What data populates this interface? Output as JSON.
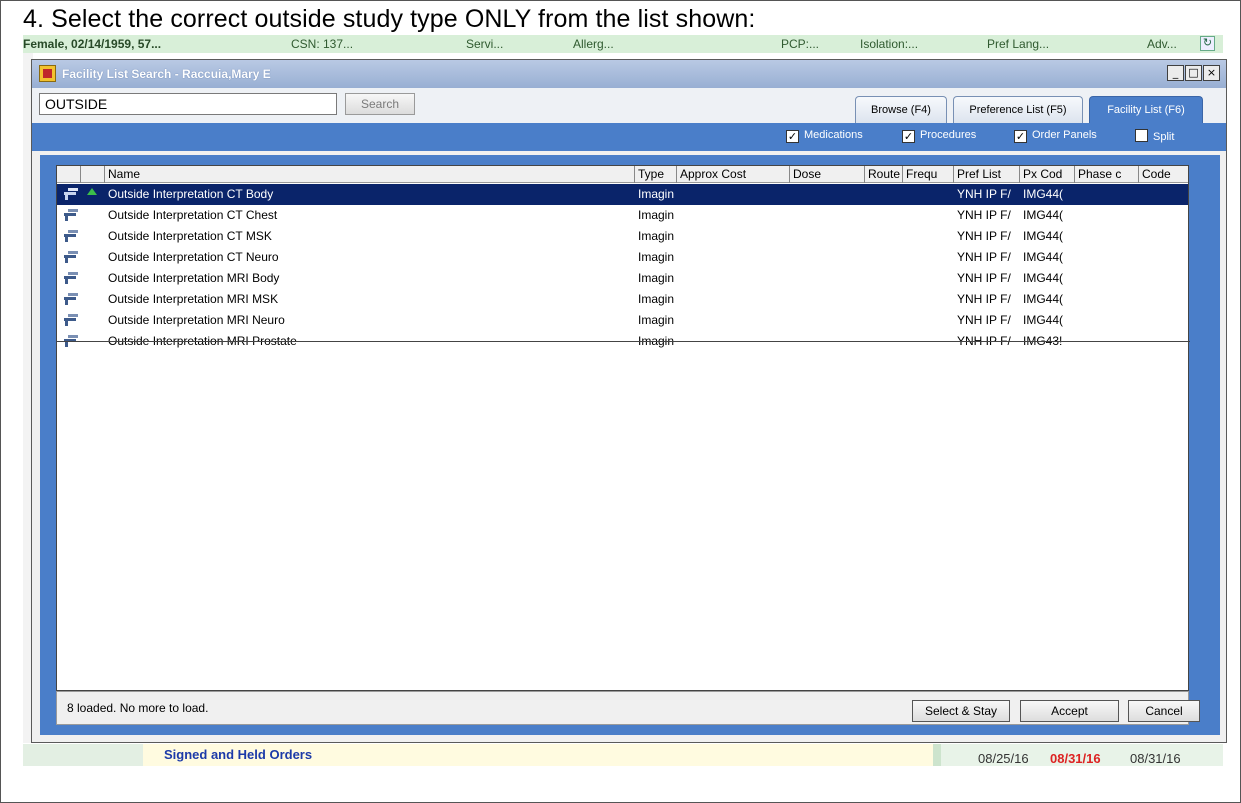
{
  "instruction": "4. Select the correct outside study type ONLY from the list shown:",
  "patient_bar": {
    "patient": "Female, 02/14/1959, 57...",
    "csn": "CSN: 137...",
    "service": "Servi...",
    "allergies": "Allerg...",
    "pcp": "PCP:...",
    "isolation": "Isolation:...",
    "pref_lang": "Pref Lang...",
    "adv": "Adv..."
  },
  "dialog": {
    "title": "Facility List Search - Raccuia,Mary E",
    "window_buttons": {
      "minimize": "_",
      "maximize": "□",
      "close": "×"
    },
    "search": {
      "value": "OUTSIDE",
      "button_label": "Search"
    },
    "tabs": [
      {
        "label": "Browse (F4)",
        "active": false
      },
      {
        "label": "Preference List (F5)",
        "active": false
      },
      {
        "label": "Facility List (F6)",
        "active": true
      }
    ],
    "filters": [
      {
        "label": "Medications",
        "checked": true
      },
      {
        "label": "Procedures",
        "checked": true
      },
      {
        "label": "Order Panels",
        "checked": true
      },
      {
        "label": "Split",
        "checked": false
      }
    ],
    "columns": [
      "Name",
      "Type",
      "Approx Cost",
      "Dose",
      "Route",
      "Frequ",
      "Pref List",
      "Px Cod",
      "Phase c",
      "Code"
    ],
    "rows": [
      {
        "name": "Outside Interpretation CT Body",
        "type": "Imagin",
        "pref_list": "YNH IP F/",
        "px_code": "IMG44(",
        "selected": true
      },
      {
        "name": "Outside Interpretation CT Chest",
        "type": "Imagin",
        "pref_list": "YNH IP F/",
        "px_code": "IMG44(",
        "selected": false
      },
      {
        "name": "Outside Interpretation CT MSK",
        "type": "Imagin",
        "pref_list": "YNH IP F/",
        "px_code": "IMG44(",
        "selected": false
      },
      {
        "name": "Outside Interpretation CT Neuro",
        "type": "Imagin",
        "pref_list": "YNH IP F/",
        "px_code": "IMG44(",
        "selected": false
      },
      {
        "name": "Outside Interpretation MRI Body",
        "type": "Imagin",
        "pref_list": "YNH IP F/",
        "px_code": "IMG44(",
        "selected": false
      },
      {
        "name": "Outside Interpretation MRI MSK",
        "type": "Imagin",
        "pref_list": "YNH IP F/",
        "px_code": "IMG44(",
        "selected": false
      },
      {
        "name": "Outside Interpretation MRI Neuro",
        "type": "Imagin",
        "pref_list": "YNH IP F/",
        "px_code": "IMG44(",
        "selected": false
      },
      {
        "name": "Outside Interpretation MRI Prostate",
        "type": "Imagin",
        "pref_list": "YNH IP F/",
        "px_code": "IMG43!",
        "selected": false
      }
    ],
    "status": "8 loaded. No more to load.",
    "buttons": {
      "select_stay": "Select & Stay",
      "accept": "Accept",
      "cancel": "Cancel"
    }
  },
  "background": {
    "signed_held": "Signed and Held Orders",
    "dates": [
      "08/25/16",
      "08/31/16",
      "08/31/16"
    ]
  },
  "colors": {
    "accent_blue": "#4a7ec9",
    "selection": "#0a246a",
    "date_highlight": "#dd2222"
  }
}
